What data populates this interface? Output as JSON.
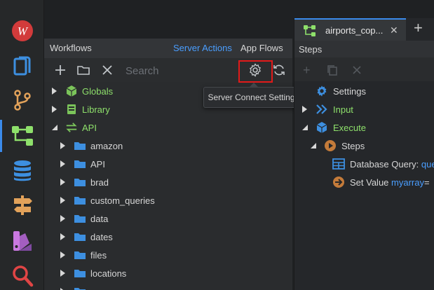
{
  "sidebar": {
    "items": [
      {
        "icon": "wappler-logo-icon"
      },
      {
        "icon": "pages-icon"
      },
      {
        "icon": "git-icon"
      },
      {
        "icon": "workflows-icon"
      },
      {
        "icon": "database-icon"
      },
      {
        "icon": "routing-signpost-icon"
      },
      {
        "icon": "design-icon"
      },
      {
        "icon": "search-icon"
      }
    ]
  },
  "workflows": {
    "title": "Workflows",
    "server_actions": "Server Actions",
    "app_flows": "App Flows",
    "search": {
      "placeholder": "Search",
      "value": ""
    },
    "tooltip": "Server Connect Settings",
    "tree": [
      {
        "label": "Globals",
        "icon": "cube-icon",
        "expanded": false
      },
      {
        "label": "Library",
        "icon": "book-icon",
        "expanded": false
      },
      {
        "label": "API",
        "icon": "swap-arrows-icon",
        "expanded": true
      },
      {
        "label": "amazon",
        "icon": "folder-icon"
      },
      {
        "label": "API",
        "icon": "folder-icon"
      },
      {
        "label": "brad",
        "icon": "folder-icon"
      },
      {
        "label": "custom_queries",
        "icon": "folder-icon"
      },
      {
        "label": "data",
        "icon": "folder-icon"
      },
      {
        "label": "dates",
        "icon": "folder-icon"
      },
      {
        "label": "files",
        "icon": "folder-icon"
      },
      {
        "label": "locations",
        "icon": "folder-icon"
      },
      {
        "label": "...",
        "icon": "folder-icon"
      }
    ]
  },
  "editor": {
    "tab_label": "airports_cop...",
    "steps_title": "Steps",
    "steps": [
      {
        "label": "Settings"
      },
      {
        "label": "Input"
      },
      {
        "label": "Execute"
      },
      {
        "label": "Steps"
      },
      {
        "label": "Database Query:",
        "value": "que"
      },
      {
        "label": "Set Value",
        "value": "myarray",
        "suffix": " ="
      }
    ]
  },
  "colors": {
    "accent_blue": "#4a9eff",
    "active_bar": "#3b8beb",
    "green_label": "#8ee06b",
    "highlight_red": "#e21a1a",
    "folder_blue": "#3d8fe0"
  }
}
